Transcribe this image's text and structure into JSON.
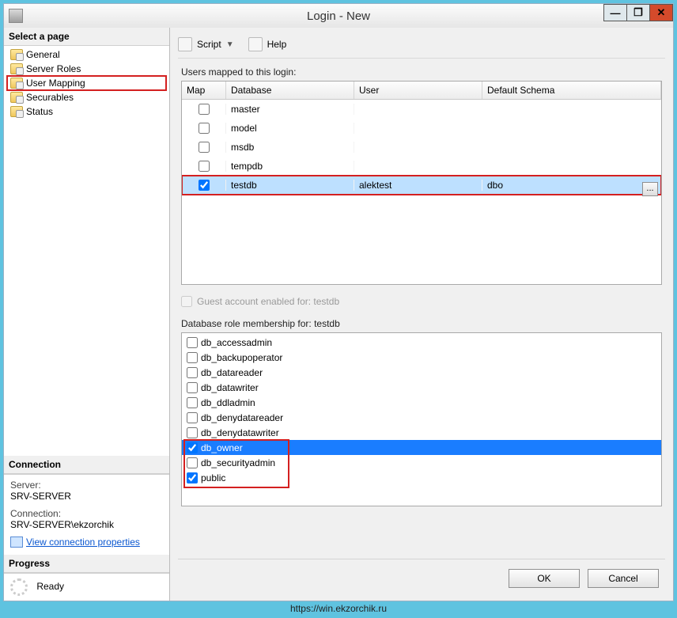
{
  "window": {
    "title": "Login - New"
  },
  "leftpanel": {
    "select_page_label": "Select a page",
    "nav": [
      {
        "label": "General",
        "highlighted": false
      },
      {
        "label": "Server Roles",
        "highlighted": false
      },
      {
        "label": "User Mapping",
        "highlighted": true
      },
      {
        "label": "Securables",
        "highlighted": false
      },
      {
        "label": "Status",
        "highlighted": false
      }
    ],
    "connection": {
      "title": "Connection",
      "server_label": "Server:",
      "server_value": "SRV-SERVER",
      "conn_label": "Connection:",
      "conn_value": "SRV-SERVER\\ekzorchik",
      "link_text": "View connection properties"
    },
    "progress": {
      "title": "Progress",
      "status": "Ready"
    }
  },
  "toolbar": {
    "script_label": "Script",
    "help_label": "Help"
  },
  "usermap": {
    "label": "Users mapped to this login:",
    "headers": {
      "map": "Map",
      "database": "Database",
      "user": "User",
      "schema": "Default Schema"
    },
    "rows": [
      {
        "checked": false,
        "database": "master",
        "user": "",
        "schema": "",
        "selected": false
      },
      {
        "checked": false,
        "database": "model",
        "user": "",
        "schema": "",
        "selected": false
      },
      {
        "checked": false,
        "database": "msdb",
        "user": "",
        "schema": "",
        "selected": false
      },
      {
        "checked": false,
        "database": "tempdb",
        "user": "",
        "schema": "",
        "selected": false
      },
      {
        "checked": true,
        "database": "testdb",
        "user": "alektest",
        "schema": "dbo",
        "selected": true
      }
    ]
  },
  "guest": {
    "label": "Guest account enabled for: testdb",
    "checked": false
  },
  "roles": {
    "label": "Database role membership for: testdb",
    "items": [
      {
        "name": "db_accessadmin",
        "checked": false,
        "selected": false
      },
      {
        "name": "db_backupoperator",
        "checked": false,
        "selected": false
      },
      {
        "name": "db_datareader",
        "checked": false,
        "selected": false
      },
      {
        "name": "db_datawriter",
        "checked": false,
        "selected": false
      },
      {
        "name": "db_ddladmin",
        "checked": false,
        "selected": false
      },
      {
        "name": "db_denydatareader",
        "checked": false,
        "selected": false
      },
      {
        "name": "db_denydatawriter",
        "checked": false,
        "selected": false
      },
      {
        "name": "db_owner",
        "checked": true,
        "selected": true
      },
      {
        "name": "db_securityadmin",
        "checked": false,
        "selected": false
      },
      {
        "name": "public",
        "checked": true,
        "selected": false
      }
    ]
  },
  "buttons": {
    "ok": "OK",
    "cancel": "Cancel"
  },
  "footer_url": "https://win.ekzorchik.ru"
}
